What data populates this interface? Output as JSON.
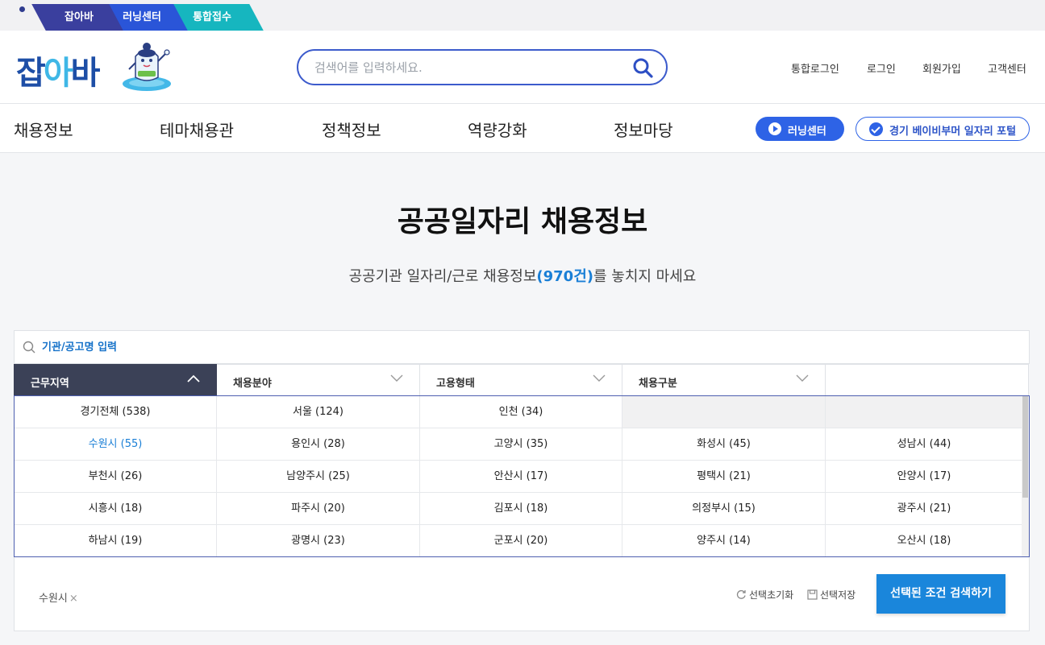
{
  "site_tabs": [
    "잡아바",
    "러닝센터",
    "통합접수"
  ],
  "logo": {
    "part1": "잡",
    "part2": "아",
    "part3": "바"
  },
  "search": {
    "placeholder": "검색어를 입력하세요."
  },
  "util_links": [
    "통합로그인",
    "로그인",
    "회원가입",
    "고객센터"
  ],
  "gnb": [
    "채용정보",
    "테마채용관",
    "정책정보",
    "역량강화",
    "정보마당"
  ],
  "buttons": {
    "learning_center": "러닝센터",
    "portal": "경기 베이비부머 일자리 포털"
  },
  "hero": {
    "title": "공공일자리 채용정보",
    "sub_before": "공공기관 일자리/근로 채용정보",
    "count": "(970건)",
    "sub_after": "를 놓치지 마세요"
  },
  "filter": {
    "keyword_placeholder": "기관/공고명 입력",
    "categories": [
      "근무지역",
      "채용분야",
      "고용형태",
      "채용구분"
    ],
    "regions": [
      [
        "경기전체 (538)",
        "서울 (124)",
        "인천 (34)",
        "",
        ""
      ],
      [
        "수원시 (55)",
        "용인시 (28)",
        "고양시 (35)",
        "화성시 (45)",
        "성남시 (44)"
      ],
      [
        "부천시 (26)",
        "남양주시 (25)",
        "안산시 (17)",
        "평택시 (21)",
        "안양시 (17)"
      ],
      [
        "시흥시 (18)",
        "파주시 (20)",
        "김포시 (18)",
        "의정부시 (15)",
        "광주시 (21)"
      ],
      [
        "하남시 (19)",
        "광명시 (23)",
        "군포시 (20)",
        "양주시 (14)",
        "오산시 (18)"
      ]
    ],
    "selected_region": "수원시 (55)",
    "selected_chip": "수원시",
    "chip_remove": "×",
    "reset_label": "선택초기화",
    "save_label": "선택저장",
    "search_button": "선택된 조건 검색하기"
  },
  "colors": {
    "brand_blue": "#2e63e6",
    "accent_blue": "#1a86db",
    "active_tab": "#3b4157"
  }
}
